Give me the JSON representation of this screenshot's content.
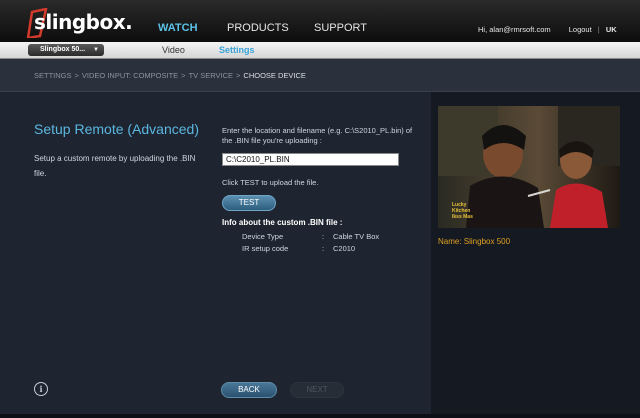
{
  "brand": {
    "logo_text": "slingbox."
  },
  "nav": {
    "watch": "WATCH",
    "products": "PRODUCTS",
    "support": "SUPPORT"
  },
  "user": {
    "greeting": "Hi, alan@rmrsoft.com",
    "logout": "Logout",
    "separator": "|",
    "region": "UK"
  },
  "subbar": {
    "device": "Slingbox 50...",
    "tab_video": "Video",
    "tab_settings": "Settings"
  },
  "breadcrumb": {
    "items": [
      "SETTINGS",
      "VIDEO INPUT: COMPOSITE",
      "TV SERVICE"
    ],
    "current": "CHOOSE DEVICE",
    "separator": ">"
  },
  "page": {
    "title": "Setup Remote (Advanced)",
    "description": "Setup a custom remote by uploading the .BIN file.",
    "instruction": "Enter the location and filename (e.g. C:\\S2010_PL.bin) of the .BIN file you're uploading :",
    "file_value": "C:\\C2010_PL.BIN",
    "click_test": "Click TEST to upload the file.",
    "test_button": "TEST",
    "info_heading": "Info about the custom .BIN file :",
    "info": [
      {
        "label": "Device Type",
        "colon": ":",
        "value": "Cable TV Box"
      },
      {
        "label": "IR setup code",
        "colon": ":",
        "value": "C2010"
      }
    ],
    "back_button": "BACK",
    "next_button": "NEXT",
    "help_icon": "i"
  },
  "preview": {
    "caption": "Name: Slingbox 500",
    "overlay": [
      "Lucky",
      "Kitchen",
      "Ikss Mas"
    ]
  },
  "colors": {
    "accent_blue": "#5ab7e0",
    "caption_gold": "#e0a020",
    "header_dark": "#0d0d0d",
    "content_bg": "#1f2530"
  }
}
